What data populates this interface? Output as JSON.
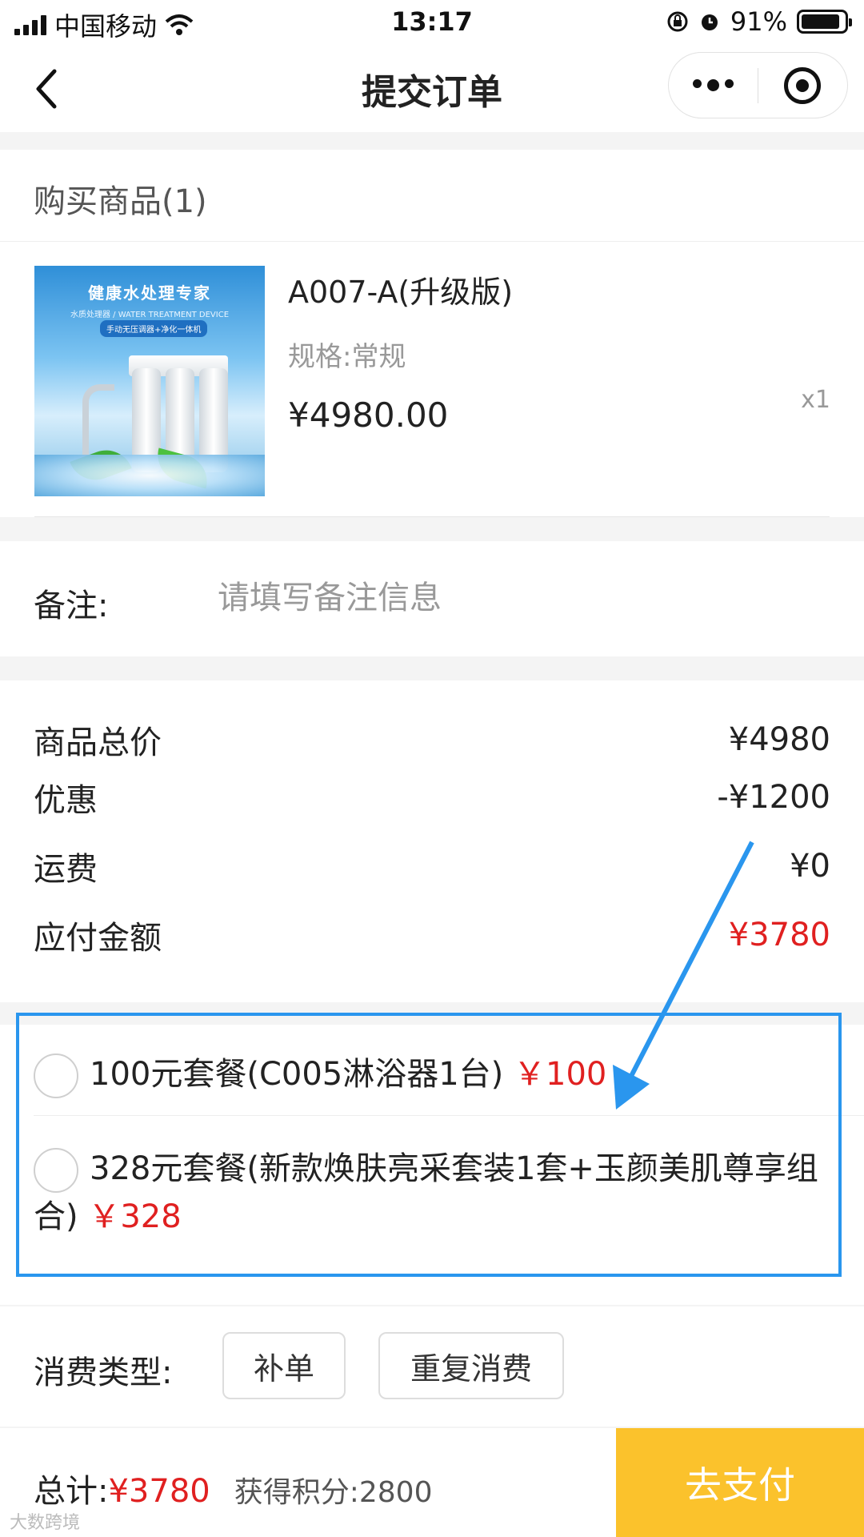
{
  "status_bar": {
    "carrier": "中国移动",
    "time": "13:17",
    "battery_percent": "91%",
    "battery_level": 0.91
  },
  "nav": {
    "title": "提交订单"
  },
  "goods": {
    "section_title": "购买商品(1)",
    "image_title": "健康水处理专家",
    "image_subtitle": "水质处理器 / WATER TREATMENT DEVICE",
    "image_badge": "手动无压调器+净化一体机",
    "name": "A007-A(升级版)",
    "spec": "规格:常规",
    "price": "¥4980.00",
    "qty": "x1"
  },
  "remark": {
    "label": "备注:",
    "placeholder": "请填写备注信息",
    "value": ""
  },
  "summary": {
    "rows": [
      {
        "label": "商品总价",
        "value": "¥4980"
      },
      {
        "label": "优惠",
        "value": "-¥1200"
      },
      {
        "label": "运费",
        "value": "¥0"
      },
      {
        "label": "应付金额",
        "value": "¥3780"
      }
    ],
    "highlight_color": "#e02020"
  },
  "packages": [
    {
      "label": "100元套餐(C005淋浴器1台)",
      "price": "￥100",
      "selected": false
    },
    {
      "label": "328元套餐(新款焕肤亮采套装1套+玉颜美肌尊享组合)",
      "price": "￥328",
      "selected": false
    }
  ],
  "consume_type": {
    "label": "消费类型:",
    "options": [
      "补单",
      "重复消费"
    ]
  },
  "footer": {
    "total_label": "总计:",
    "total_amount": "¥3780",
    "points": "获得积分:2800",
    "pay_label": "去支付",
    "pay_color": "#fbc22c"
  },
  "watermark": "大数跨境",
  "annotation_color": "#2a96ee"
}
